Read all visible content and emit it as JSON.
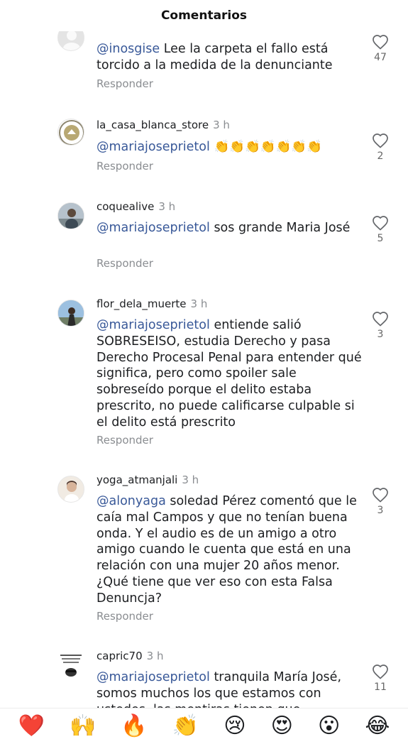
{
  "header": {
    "title": "Comentarios"
  },
  "comments": [
    {
      "username": "",
      "time": "",
      "mention": "@inosgise",
      "text": " Lee la carpeta el fallo está torcido a la medida de la denunciante",
      "reply_label": "Responder",
      "likes": "47",
      "avatar_icon": "person-icon"
    },
    {
      "username": "la_casa_blanca_store",
      "time": "3 h",
      "mention": "@mariajoseprietol",
      "text": " 👏👏👏👏👏👏👏",
      "reply_label": "Responder",
      "likes": "2",
      "avatar_icon": "house-logo-icon"
    },
    {
      "username": "coquealive",
      "time": "3 h",
      "mention": "@mariajoseprietol",
      "text": " sos grande Maria José",
      "reply_label": "Responder",
      "likes": "5",
      "avatar_icon": "person-icon"
    },
    {
      "username": "flor_dela_muerte",
      "time": "3 h",
      "mention": "@mariajoseprietol",
      "text": " entiende salió SOBRESEISO, estudia Derecho y pasa Derecho Procesal Penal para entender qué significa, pero como spoiler sale sobreseído porque el delito estaba prescrito, no puede calificarse culpable si el delito está prescrito",
      "reply_label": "Responder",
      "likes": "3",
      "avatar_icon": "person-icon"
    },
    {
      "username": "yoga_atmanjali",
      "time": "3 h",
      "mention": "@alonyaga",
      "text": " soledad Pérez comentó que le caía mal Campos y que no tenían buena onda. Y el audio es de un amigo a otro amigo cuando le cuenta que está en una relación con una mujer 20 años menor. ¿Qué tiene que ver eso con esta Falsa Denuncja?",
      "reply_label": "Responder",
      "likes": "3",
      "avatar_icon": "person-icon"
    },
    {
      "username": "capric70",
      "time": "3 h",
      "mention": "@mariajoseprietol",
      "text": " tranquila María José, somos muchos los que estamos con ustedes, las mentiras tienen que",
      "reply_label": "",
      "likes": "11",
      "avatar_icon": "meme-icon"
    }
  ],
  "emoji_bar": [
    "❤️",
    "🙌",
    "🔥",
    "👏",
    "😢",
    "😍",
    "😮",
    "😂"
  ]
}
